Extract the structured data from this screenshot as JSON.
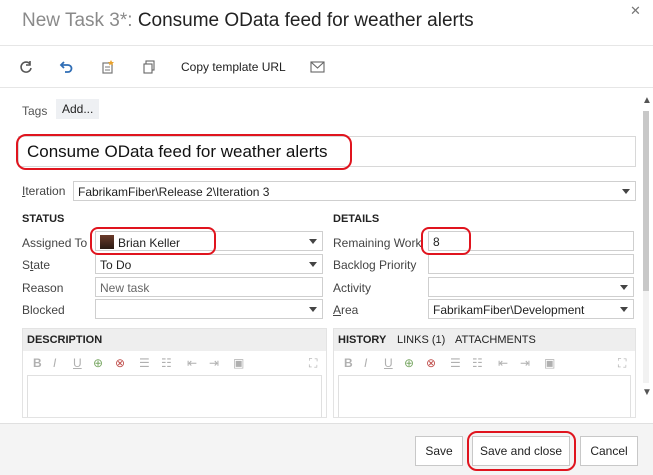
{
  "dialog": {
    "title_prefix": "New Task 3*:",
    "title_text": "Consume OData feed for weather alerts",
    "close_glyph": "✕"
  },
  "toolbar": {
    "refresh_icon": "refresh-icon",
    "undo_icon": "undo-icon",
    "template_icon": "template-icon",
    "copy_icon": "copy-icon",
    "copy_template_url": "Copy template URL",
    "email_icon": "email-icon"
  },
  "tags": {
    "label": "Tags",
    "add_label": "Add..."
  },
  "work_item_title": "Consume OData feed for weather alerts",
  "iteration": {
    "label": "Iteration",
    "value": "FabrikamFiber\\Release 2\\Iteration 3"
  },
  "status": {
    "heading": "STATUS",
    "assigned_to_label": "Assigned To",
    "assigned_to_value": "Brian Keller",
    "state_label": "State",
    "state_value": "To Do",
    "reason_label": "Reason",
    "reason_value": "New task",
    "blocked_label": "Blocked",
    "blocked_value": ""
  },
  "details": {
    "heading": "DETAILS",
    "remaining_work_label": "Remaining Work",
    "remaining_work_value": "8",
    "backlog_priority_label": "Backlog Priority",
    "backlog_priority_value": "",
    "activity_label": "Activity",
    "activity_value": "",
    "area_label": "Area",
    "area_value": "FabrikamFiber\\Development"
  },
  "description": {
    "heading": "DESCRIPTION"
  },
  "history_tabs": {
    "history": "HISTORY",
    "links": "LINKS (1)",
    "attachments": "ATTACHMENTS"
  },
  "rich_text_toolbar": {
    "bold": "B",
    "italic": "I",
    "underline": "U"
  },
  "footer": {
    "save": "Save",
    "save_and_close": "Save and close",
    "cancel": "Cancel"
  },
  "colors": {
    "highlight": "#e0141e",
    "section_bg": "#eeeeee"
  }
}
